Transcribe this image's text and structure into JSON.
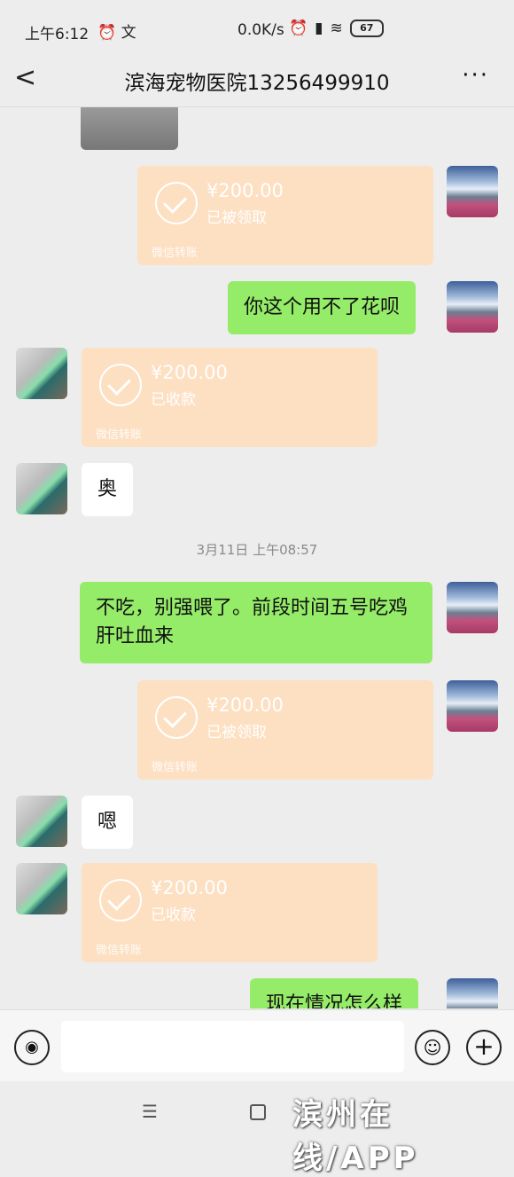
{
  "status_bar": {
    "time": "上午6:12",
    "network_speed": "0.0K/s",
    "battery": "67"
  },
  "header": {
    "title": "滨海宠物医院13256499910",
    "more": "···"
  },
  "messages": {
    "transfer1": {
      "amount": "¥200.00",
      "status": "已被领取",
      "footer": "微信转账"
    },
    "msg_huabei": "你这个用不了花呗",
    "transfer2": {
      "amount": "¥200.00",
      "status": "已收款",
      "footer": "微信转账"
    },
    "msg_ao": "奥",
    "timestamp": "3月11日 上午08:57",
    "msg_long": "不吃，别强喂了。前段时间五号吃鸡肝吐血来",
    "transfer3": {
      "amount": "¥200.00",
      "status": "已被领取",
      "footer": "微信转账"
    },
    "msg_en": "嗯",
    "transfer4": {
      "amount": "¥200.00",
      "status": "已收款",
      "footer": "微信转账"
    },
    "msg_now": "现在情况怎么样"
  },
  "input_bar": {
    "voice_icon": "voice-icon",
    "emoji_icon": "emoji-icon",
    "plus_icon": "plus-icon"
  },
  "nav": {
    "menu_glyph": "☰"
  },
  "watermark": "滨州在线/APP"
}
